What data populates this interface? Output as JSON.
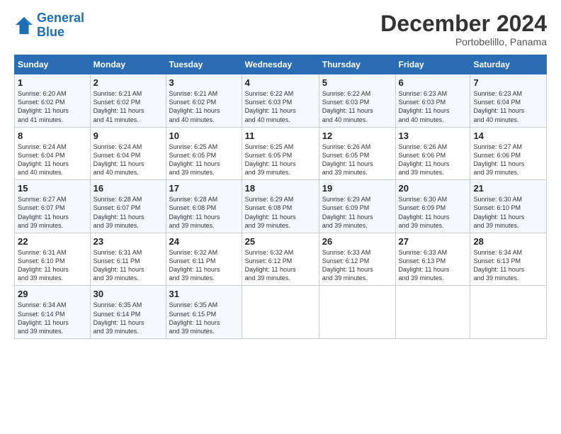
{
  "logo": {
    "line1": "General",
    "line2": "Blue"
  },
  "title": "December 2024",
  "location": "Portobelillo, Panama",
  "days_of_week": [
    "Sunday",
    "Monday",
    "Tuesday",
    "Wednesday",
    "Thursday",
    "Friday",
    "Saturday"
  ],
  "weeks": [
    [
      {
        "day": 1,
        "info": "Sunrise: 6:20 AM\nSunset: 6:02 PM\nDaylight: 11 hours\nand 41 minutes."
      },
      {
        "day": 2,
        "info": "Sunrise: 6:21 AM\nSunset: 6:02 PM\nDaylight: 11 hours\nand 41 minutes."
      },
      {
        "day": 3,
        "info": "Sunrise: 6:21 AM\nSunset: 6:02 PM\nDaylight: 11 hours\nand 40 minutes."
      },
      {
        "day": 4,
        "info": "Sunrise: 6:22 AM\nSunset: 6:03 PM\nDaylight: 11 hours\nand 40 minutes."
      },
      {
        "day": 5,
        "info": "Sunrise: 6:22 AM\nSunset: 6:03 PM\nDaylight: 11 hours\nand 40 minutes."
      },
      {
        "day": 6,
        "info": "Sunrise: 6:23 AM\nSunset: 6:03 PM\nDaylight: 11 hours\nand 40 minutes."
      },
      {
        "day": 7,
        "info": "Sunrise: 6:23 AM\nSunset: 6:04 PM\nDaylight: 11 hours\nand 40 minutes."
      }
    ],
    [
      {
        "day": 8,
        "info": "Sunrise: 6:24 AM\nSunset: 6:04 PM\nDaylight: 11 hours\nand 40 minutes."
      },
      {
        "day": 9,
        "info": "Sunrise: 6:24 AM\nSunset: 6:04 PM\nDaylight: 11 hours\nand 40 minutes."
      },
      {
        "day": 10,
        "info": "Sunrise: 6:25 AM\nSunset: 6:05 PM\nDaylight: 11 hours\nand 39 minutes."
      },
      {
        "day": 11,
        "info": "Sunrise: 6:25 AM\nSunset: 6:05 PM\nDaylight: 11 hours\nand 39 minutes."
      },
      {
        "day": 12,
        "info": "Sunrise: 6:26 AM\nSunset: 6:05 PM\nDaylight: 11 hours\nand 39 minutes."
      },
      {
        "day": 13,
        "info": "Sunrise: 6:26 AM\nSunset: 6:06 PM\nDaylight: 11 hours\nand 39 minutes."
      },
      {
        "day": 14,
        "info": "Sunrise: 6:27 AM\nSunset: 6:06 PM\nDaylight: 11 hours\nand 39 minutes."
      }
    ],
    [
      {
        "day": 15,
        "info": "Sunrise: 6:27 AM\nSunset: 6:07 PM\nDaylight: 11 hours\nand 39 minutes."
      },
      {
        "day": 16,
        "info": "Sunrise: 6:28 AM\nSunset: 6:07 PM\nDaylight: 11 hours\nand 39 minutes."
      },
      {
        "day": 17,
        "info": "Sunrise: 6:28 AM\nSunset: 6:08 PM\nDaylight: 11 hours\nand 39 minutes."
      },
      {
        "day": 18,
        "info": "Sunrise: 6:29 AM\nSunset: 6:08 PM\nDaylight: 11 hours\nand 39 minutes."
      },
      {
        "day": 19,
        "info": "Sunrise: 6:29 AM\nSunset: 6:09 PM\nDaylight: 11 hours\nand 39 minutes."
      },
      {
        "day": 20,
        "info": "Sunrise: 6:30 AM\nSunset: 6:09 PM\nDaylight: 11 hours\nand 39 minutes."
      },
      {
        "day": 21,
        "info": "Sunrise: 6:30 AM\nSunset: 6:10 PM\nDaylight: 11 hours\nand 39 minutes."
      }
    ],
    [
      {
        "day": 22,
        "info": "Sunrise: 6:31 AM\nSunset: 6:10 PM\nDaylight: 11 hours\nand 39 minutes."
      },
      {
        "day": 23,
        "info": "Sunrise: 6:31 AM\nSunset: 6:11 PM\nDaylight: 11 hours\nand 39 minutes."
      },
      {
        "day": 24,
        "info": "Sunrise: 6:32 AM\nSunset: 6:11 PM\nDaylight: 11 hours\nand 39 minutes."
      },
      {
        "day": 25,
        "info": "Sunrise: 6:32 AM\nSunset: 6:12 PM\nDaylight: 11 hours\nand 39 minutes."
      },
      {
        "day": 26,
        "info": "Sunrise: 6:33 AM\nSunset: 6:12 PM\nDaylight: 11 hours\nand 39 minutes."
      },
      {
        "day": 27,
        "info": "Sunrise: 6:33 AM\nSunset: 6:13 PM\nDaylight: 11 hours\nand 39 minutes."
      },
      {
        "day": 28,
        "info": "Sunrise: 6:34 AM\nSunset: 6:13 PM\nDaylight: 11 hours\nand 39 minutes."
      }
    ],
    [
      {
        "day": 29,
        "info": "Sunrise: 6:34 AM\nSunset: 6:14 PM\nDaylight: 11 hours\nand 39 minutes."
      },
      {
        "day": 30,
        "info": "Sunrise: 6:35 AM\nSunset: 6:14 PM\nDaylight: 11 hours\nand 39 minutes."
      },
      {
        "day": 31,
        "info": "Sunrise: 6:35 AM\nSunset: 6:15 PM\nDaylight: 11 hours\nand 39 minutes."
      },
      null,
      null,
      null,
      null
    ]
  ]
}
